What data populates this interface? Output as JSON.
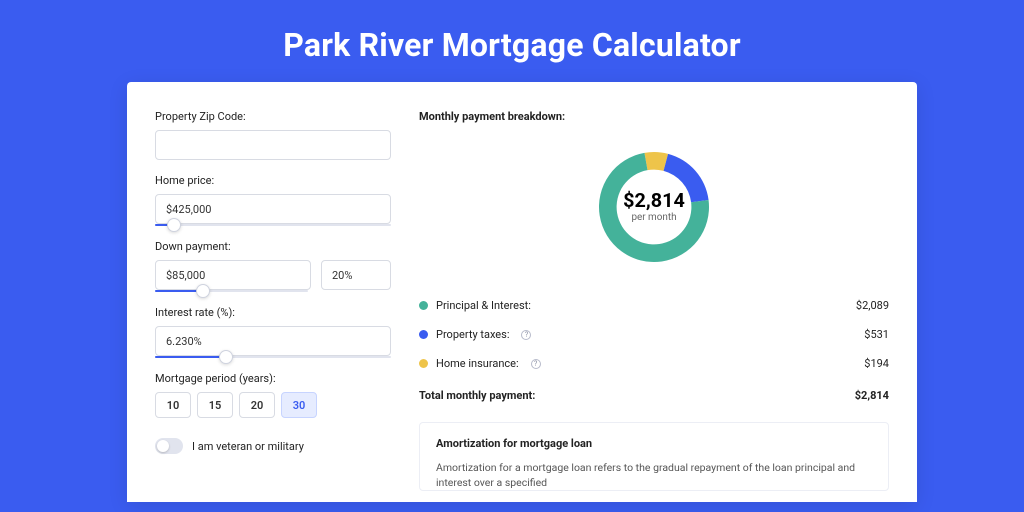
{
  "title": "Park River Mortgage Calculator",
  "form": {
    "zip": {
      "label": "Property Zip Code:",
      "value": ""
    },
    "home_price": {
      "label": "Home price:",
      "value": "$425,000",
      "slider_pct": 8
    },
    "down_payment": {
      "label": "Down payment:",
      "amount": "$85,000",
      "percent": "20%",
      "slider_pct": 20
    },
    "interest": {
      "label": "Interest rate (%):",
      "value": "6.230%",
      "slider_pct": 30
    },
    "period": {
      "label": "Mortgage period (years):",
      "options": [
        "10",
        "15",
        "20",
        "30"
      ],
      "active": "30"
    },
    "veteran": {
      "label": "I am veteran or military",
      "on": false
    }
  },
  "breakdown": {
    "title": "Monthly payment breakdown:",
    "center_amount": "$2,814",
    "center_sub": "per month",
    "items": [
      {
        "label": "Principal & Interest:",
        "value": "$2,089",
        "color": "green",
        "info": false
      },
      {
        "label": "Property taxes:",
        "value": "$531",
        "color": "blue",
        "info": true
      },
      {
        "label": "Home insurance:",
        "value": "$194",
        "color": "yellow",
        "info": true
      }
    ],
    "total_label": "Total monthly payment:",
    "total_value": "$2,814"
  },
  "chart_data": {
    "type": "pie",
    "title": "Monthly payment breakdown",
    "series": [
      {
        "name": "Principal & Interest",
        "value": 2089,
        "color": "#44b29a"
      },
      {
        "name": "Property taxes",
        "value": 531,
        "color": "#3a5cf0"
      },
      {
        "name": "Home insurance",
        "value": 194,
        "color": "#eec44a"
      }
    ],
    "total": 2814,
    "unit": "USD per month"
  },
  "amortization": {
    "title": "Amortization for mortgage loan",
    "text": "Amortization for a mortgage loan refers to the gradual repayment of the loan principal and interest over a specified"
  }
}
